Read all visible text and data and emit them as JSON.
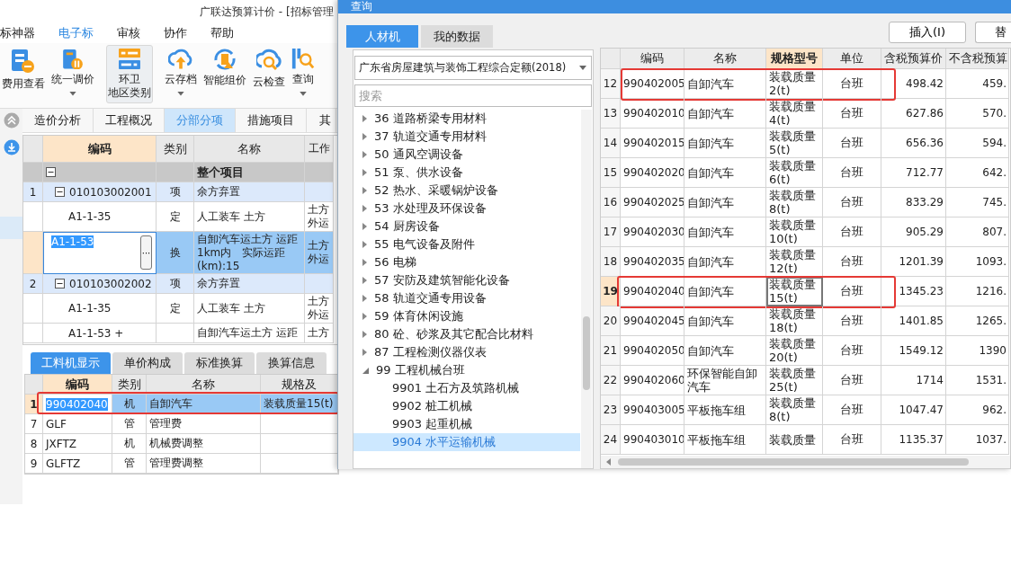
{
  "main_window": {
    "title": "广联达预算计价 - [招标管理",
    "menu": [
      {
        "label": "标神器",
        "selected": false
      },
      {
        "label": "电子标",
        "selected": true
      },
      {
        "label": "审核",
        "selected": false
      },
      {
        "label": "协作",
        "selected": false
      },
      {
        "label": "帮助",
        "selected": false
      }
    ],
    "toolbar": [
      {
        "kind": "document",
        "label": "费用查看",
        "dropdown": false,
        "selected": false
      },
      {
        "kind": "adjust",
        "label": "统一调价",
        "dropdown": true,
        "selected": false
      },
      {
        "kind": "panel",
        "label": "环卫",
        "second_line": "地区类别",
        "dropdown": false,
        "selected": true
      },
      {
        "kind": "cloud-upload",
        "label": "云存档",
        "dropdown": true,
        "selected": false
      },
      {
        "kind": "refresh",
        "label": "智能组价",
        "dropdown": false,
        "selected": false
      },
      {
        "kind": "cloud-search",
        "label": "云检查",
        "dropdown": false,
        "selected": false
      },
      {
        "kind": "search",
        "label": "查询",
        "dropdown": true,
        "selected": false
      }
    ],
    "view_tabs": [
      {
        "label": "造价分析",
        "selected": false
      },
      {
        "label": "工程概况",
        "selected": false
      },
      {
        "label": "分部分项",
        "selected": true
      },
      {
        "label": "措施项目",
        "selected": false
      },
      {
        "label": "其",
        "selected": false
      }
    ],
    "grid": {
      "columns": [
        "编码",
        "类别",
        "名称",
        "工作"
      ],
      "rows": [
        {
          "kind": "group",
          "name": "整个项目",
          "expanded": true,
          "selected": false
        },
        {
          "kind": "item",
          "number": "1",
          "code": "010103002001",
          "type": "项",
          "name": "余方弃置",
          "expanded": true,
          "selected": false
        },
        {
          "kind": "sub",
          "code": "A1-1-35",
          "type": "定",
          "name": "人工装车 土方",
          "content": "土方外运",
          "selected": false
        },
        {
          "kind": "sub",
          "code": "A1-1-53",
          "edit_button": "···",
          "type": "换",
          "name": "自卸汽车运土方 运距1km内　实际运距(km):15",
          "content": "土方外运",
          "selected": true
        },
        {
          "kind": "item",
          "number": "2",
          "code": "010103002002",
          "type": "项",
          "name": "余方弃置",
          "expanded": true,
          "selected": false
        },
        {
          "kind": "sub",
          "code": "A1-1-35",
          "type": "定",
          "name": "人工装车 土方",
          "content": "土方外运",
          "selected": false
        },
        {
          "kind": "sub",
          "code": "A1-1-53 +",
          "name": "自卸汽车运土方 运距",
          "content": "土方",
          "selected": false
        }
      ]
    },
    "detail_tabs": [
      {
        "label": "工料机显示",
        "selected": true
      },
      {
        "label": "单价构成",
        "selected": false
      },
      {
        "label": "标准换算",
        "selected": false
      },
      {
        "label": "换算信息",
        "selected": false
      }
    ],
    "detail_grid": {
      "columns": [
        "编码",
        "类别",
        "名称",
        "规格及"
      ],
      "rows": [
        {
          "number": "1",
          "code": "990402040",
          "type": "机",
          "name": "自卸汽车",
          "spec": "装载质量15(t)",
          "selected": true,
          "highlighted": true
        },
        {
          "number": "7",
          "code": "GLF",
          "type": "管",
          "name": "管理费",
          "selected": false,
          "highlighted": false
        },
        {
          "number": "8",
          "code": "JXFTZ",
          "type": "机",
          "name": "机械费调整",
          "selected": false,
          "highlighted": false
        },
        {
          "number": "9",
          "code": "GLFTZ",
          "type": "管",
          "name": "管理费调整",
          "selected": false,
          "highlighted": false
        }
      ]
    }
  },
  "dialog": {
    "title": "查询",
    "tabs": [
      {
        "label": "人材机",
        "selected": true
      },
      {
        "label": "我的数据",
        "selected": false
      }
    ],
    "buttons": [
      "插入(I)",
      "替"
    ],
    "library": "广东省房屋建筑与装饰工程综合定额(2018)",
    "search": {
      "placeholder": "搜索"
    },
    "tree": [
      {
        "label": "36 道路桥梁专用材料",
        "expanded": false,
        "selected": false
      },
      {
        "label": "37 轨道交通专用材料",
        "expanded": false,
        "selected": false
      },
      {
        "label": "50 通风空调设备",
        "expanded": false,
        "selected": false
      },
      {
        "label": "51 泵、供水设备",
        "expanded": false,
        "selected": false
      },
      {
        "label": "52 热水、采暖锅炉设备",
        "expanded": false,
        "selected": false
      },
      {
        "label": "53 水处理及环保设备",
        "expanded": false,
        "selected": false
      },
      {
        "label": "54 厨房设备",
        "expanded": false,
        "selected": false
      },
      {
        "label": "55 电气设备及附件",
        "expanded": false,
        "selected": false
      },
      {
        "label": "56 电梯",
        "expanded": false,
        "selected": false
      },
      {
        "label": "57 安防及建筑智能化设备",
        "expanded": false,
        "selected": false
      },
      {
        "label": "58 轨道交通专用设备",
        "expanded": false,
        "selected": false
      },
      {
        "label": "59 体育休闲设施",
        "expanded": false,
        "selected": false
      },
      {
        "label": "80 砼、砂浆及其它配合比材料",
        "expanded": false,
        "selected": false
      },
      {
        "label": "87 工程检测仪器仪表",
        "expanded": false,
        "selected": false
      },
      {
        "label": "99 工程机械台班",
        "expanded": true,
        "selected": false,
        "children": [
          {
            "label": "9901 土石方及筑路机械",
            "selected": false
          },
          {
            "label": "9902 桩工机械",
            "selected": false
          },
          {
            "label": "9903 起重机械",
            "selected": false
          },
          {
            "label": "9904 水平运输机械",
            "selected": true
          }
        ]
      }
    ],
    "table": {
      "columns": [
        "编码",
        "名称",
        "规格型号",
        "单位",
        "含税预算价",
        "不含税预算"
      ],
      "rows": [
        {
          "number": "12",
          "code": "990402005",
          "name": "自卸汽车",
          "spec": "装载质量2(t)",
          "unit": "台班",
          "price_tax": "498.42",
          "price_notax": "459.",
          "selected": false,
          "highlighted": true
        },
        {
          "number": "13",
          "code": "990402010",
          "name": "自卸汽车",
          "spec": "装载质量4(t)",
          "unit": "台班",
          "price_tax": "627.86",
          "price_notax": "570.",
          "selected": false,
          "highlighted": false
        },
        {
          "number": "14",
          "code": "990402015",
          "name": "自卸汽车",
          "spec": "装载质量5(t)",
          "unit": "台班",
          "price_tax": "656.36",
          "price_notax": "594.",
          "selected": false,
          "highlighted": false
        },
        {
          "number": "15",
          "code": "990402020",
          "name": "自卸汽车",
          "spec": "装载质量6(t)",
          "unit": "台班",
          "price_tax": "712.77",
          "price_notax": "642.",
          "selected": false,
          "highlighted": false
        },
        {
          "number": "16",
          "code": "990402025",
          "name": "自卸汽车",
          "spec": "装载质量8(t)",
          "unit": "台班",
          "price_tax": "833.29",
          "price_notax": "745.",
          "selected": false,
          "highlighted": false
        },
        {
          "number": "17",
          "code": "990402030",
          "name": "自卸汽车",
          "spec": "装载质量10(t)",
          "unit": "台班",
          "price_tax": "905.29",
          "price_notax": "807.",
          "selected": false,
          "highlighted": false
        },
        {
          "number": "18",
          "code": "990402035",
          "name": "自卸汽车",
          "spec": "装载质量12(t)",
          "unit": "台班",
          "price_tax": "1201.39",
          "price_notax": "1093.",
          "selected": false,
          "highlighted": false
        },
        {
          "number": "19",
          "code": "990402040",
          "name": "自卸汽车",
          "spec": "装载质量15(t)",
          "unit": "台班",
          "price_tax": "1345.23",
          "price_notax": "1216.",
          "selected": true,
          "highlighted": true
        },
        {
          "number": "20",
          "code": "990402045",
          "name": "自卸汽车",
          "spec": "装载质量18(t)",
          "unit": "台班",
          "price_tax": "1401.85",
          "price_notax": "1265.",
          "selected": false,
          "highlighted": false
        },
        {
          "number": "21",
          "code": "990402050",
          "name": "自卸汽车",
          "spec": "装载质量20(t)",
          "unit": "台班",
          "price_tax": "1549.12",
          "price_notax": "1390",
          "selected": false,
          "highlighted": false
        },
        {
          "number": "22",
          "code": "990402060",
          "name": "环保智能自卸汽车",
          "spec": "装载质量25(t)",
          "unit": "台班",
          "price_tax": "1714",
          "price_notax": "1531.",
          "selected": false,
          "highlighted": false
        },
        {
          "number": "23",
          "code": "990403005",
          "name": "平板拖车组",
          "spec": "装载质量8(t)",
          "unit": "台班",
          "price_tax": "1047.47",
          "price_notax": "962.",
          "selected": false,
          "highlighted": false
        },
        {
          "number": "24",
          "code": "990403010",
          "name": "平板拖车组",
          "spec": "装载质量",
          "unit": "台班",
          "price_tax": "1135.37",
          "price_notax": "1037.",
          "selected": false,
          "highlighted": false
        }
      ]
    }
  }
}
